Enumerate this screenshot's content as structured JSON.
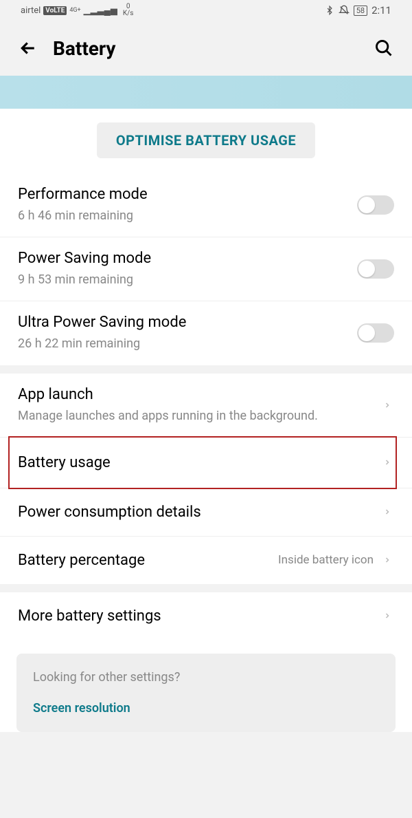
{
  "status": {
    "carrier": "airtel",
    "volte": "VoLTE",
    "net": "4G+",
    "speed_top": "0",
    "speed_unit": "K/s",
    "battery_pct": "58",
    "time": "2:11"
  },
  "header": {
    "title": "Battery"
  },
  "optimise_button": "OPTIMISE BATTERY USAGE",
  "modes": [
    {
      "title": "Performance mode",
      "sub": "6 h 46 min remaining"
    },
    {
      "title": "Power Saving mode",
      "sub": "9 h 53 min remaining"
    },
    {
      "title": "Ultra Power Saving mode",
      "sub": "26 h 22 min remaining"
    }
  ],
  "group2": {
    "app_launch": {
      "title": "App launch",
      "sub": "Manage launches and apps running in the background."
    },
    "battery_usage": {
      "title": "Battery usage"
    },
    "power_details": {
      "title": "Power consumption details"
    },
    "battery_pct": {
      "title": "Battery percentage",
      "value": "Inside battery icon"
    }
  },
  "more": {
    "title": "More battery settings"
  },
  "suggest": {
    "q": "Looking for other settings?",
    "link": "Screen resolution"
  }
}
